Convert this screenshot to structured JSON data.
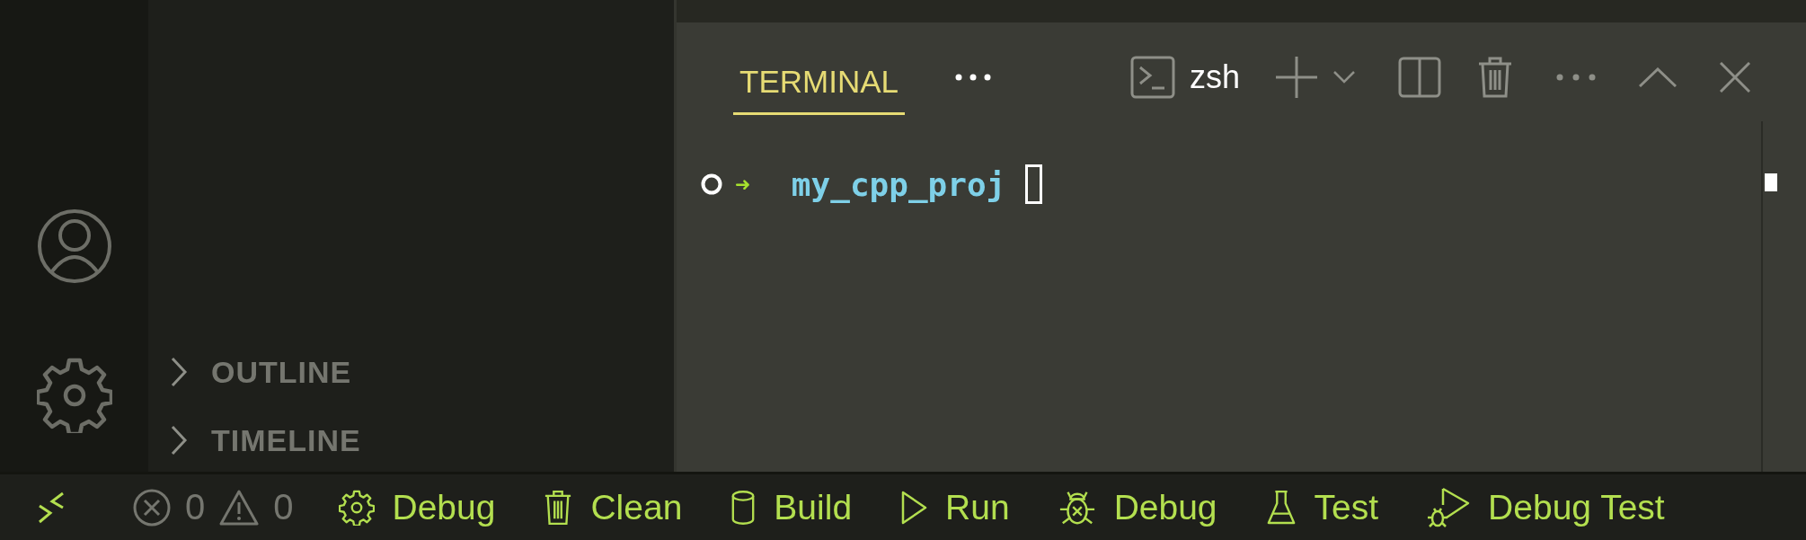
{
  "sidebar": {
    "sections": [
      {
        "label": "OUTLINE",
        "expanded": false
      },
      {
        "label": "TIMELINE",
        "expanded": false
      }
    ]
  },
  "panel": {
    "tabs": [
      {
        "label": "TERMINAL",
        "selected": true
      }
    ],
    "terminal": {
      "profile": "zsh",
      "lines": [
        {
          "arrow": "➜",
          "directory": "my_cpp_proj"
        }
      ]
    }
  },
  "status_bar": {
    "problems": {
      "errors": "0",
      "warnings": "0"
    },
    "items": [
      {
        "kind": "gear",
        "label": "Debug"
      },
      {
        "kind": "trash",
        "label": "Clean"
      },
      {
        "kind": "cylinder",
        "label": "Build"
      },
      {
        "kind": "play",
        "label": "Run"
      },
      {
        "kind": "bug",
        "label": "Debug"
      },
      {
        "kind": "flask",
        "label": "Test"
      },
      {
        "kind": "debug-test",
        "label": "Debug Test"
      }
    ]
  }
}
